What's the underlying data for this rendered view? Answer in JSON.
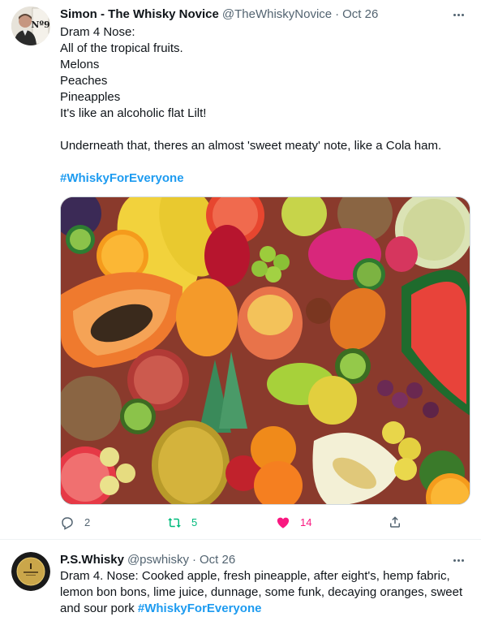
{
  "tweets": [
    {
      "display_name": "Simon - The Whisky Novice",
      "handle": "@TheWhiskyNovice",
      "separator": "·",
      "date": "Oct 26",
      "avatar_badge": "Nº9",
      "lines": [
        "Dram 4 Nose:",
        "All of the tropical fruits.",
        "Melons",
        "Peaches",
        "Pineapples",
        "It's like an alcoholic flat Lilt!",
        "",
        "Underneath that, theres an almost 'sweet meaty' note, like a Cola ham.",
        ""
      ],
      "hashtag": "#WhiskyForEveryone",
      "media_description_icon": "tropical-fruits-photo",
      "actions": {
        "reply_count": "2",
        "retweet_count": "5",
        "like_count": "14"
      },
      "colors": {
        "retweeted": "#00ba7c",
        "liked": "#f91880"
      }
    },
    {
      "display_name": "P.S.Whisky",
      "handle": "@pswhisky",
      "separator": "·",
      "date": "Oct 26",
      "lines": [
        "Dram 4. Nose: Cooked apple, fresh pineapple, after eight's, hemp fabric,",
        "lemon bon bons, lime juice, dunnage, some funk, decaying oranges, sweet"
      ],
      "last_line_prefix": "and sour pork ",
      "hashtag": "#WhiskyForEveryone"
    }
  ],
  "colors": {
    "link": "#1d9bf0",
    "secondary_text": "#536471",
    "primary_text": "#0f1419"
  }
}
